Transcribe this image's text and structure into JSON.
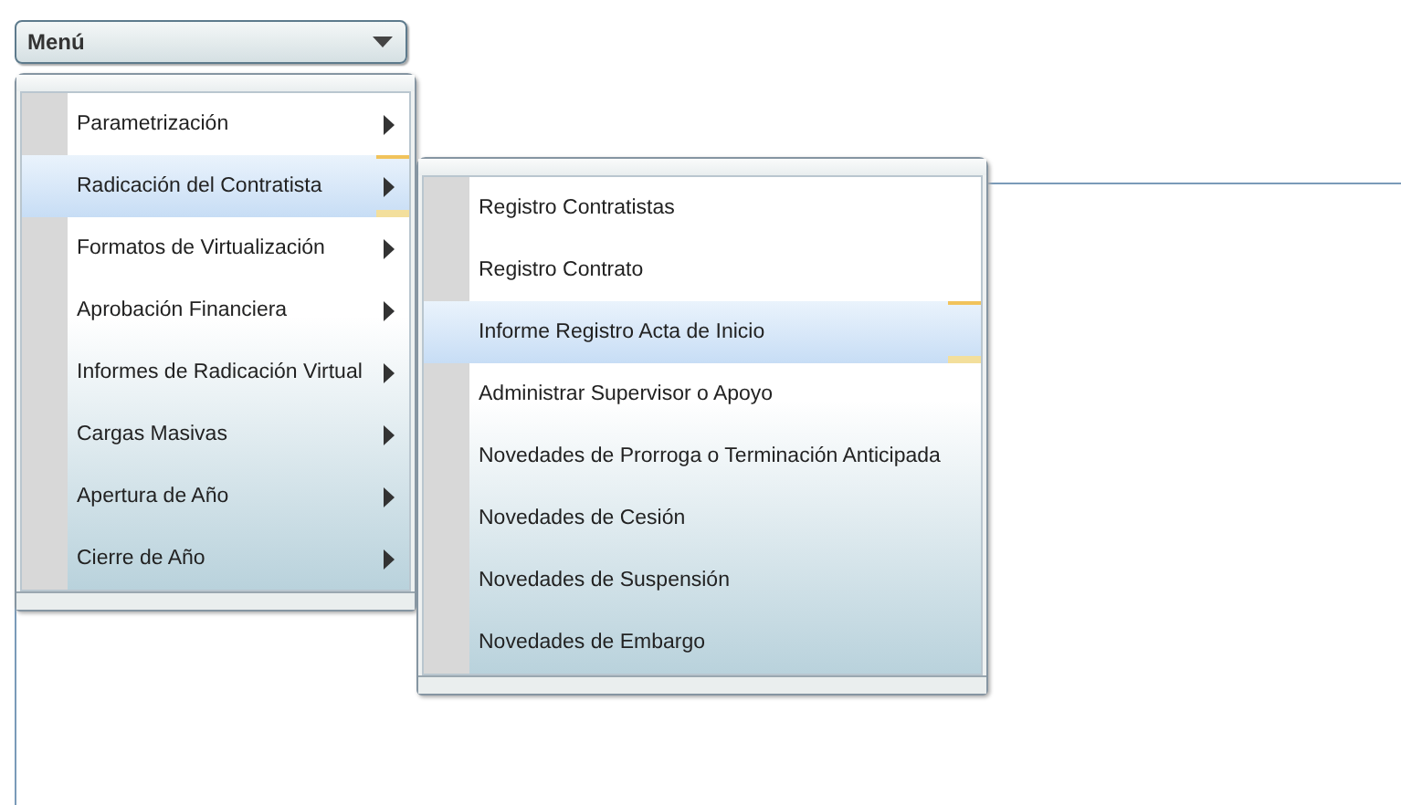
{
  "menu_button": {
    "label": "Menú"
  },
  "menu": {
    "items": [
      {
        "label": "Parametrización",
        "selected": false
      },
      {
        "label": "Radicación del Contratista",
        "selected": true
      },
      {
        "label": "Formatos de Virtualización",
        "selected": false
      },
      {
        "label": "Aprobación Financiera",
        "selected": false
      },
      {
        "label": "Informes de Radicación Virtual",
        "selected": false
      },
      {
        "label": "Cargas Masivas",
        "selected": false
      },
      {
        "label": "Apertura de Año",
        "selected": false
      },
      {
        "label": "Cierre de Año",
        "selected": false
      }
    ]
  },
  "submenu": {
    "items": [
      {
        "label": "Registro Contratistas",
        "selected": false
      },
      {
        "label": "Registro Contrato",
        "selected": false
      },
      {
        "label": "Informe Registro Acta de Inicio",
        "selected": true
      },
      {
        "label": "Administrar Supervisor o Apoyo",
        "selected": false
      },
      {
        "label": "Novedades de Prorroga o Terminación Anticipada",
        "selected": false
      },
      {
        "label": "Novedades de Cesión",
        "selected": false
      },
      {
        "label": "Novedades de Suspensión",
        "selected": false
      },
      {
        "label": "Novedades de Embargo",
        "selected": false
      }
    ]
  }
}
